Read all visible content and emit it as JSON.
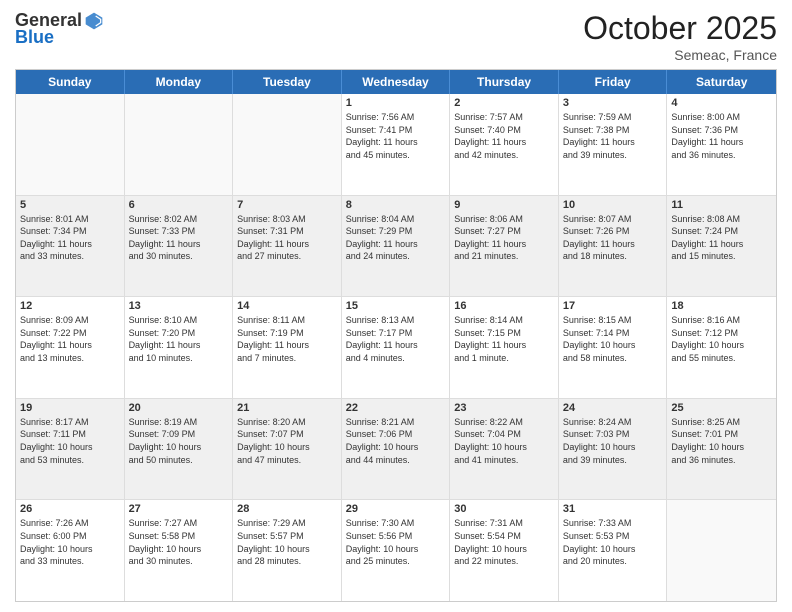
{
  "header": {
    "logo_line1": "General",
    "logo_line2": "Blue",
    "month": "October 2025",
    "location": "Semeac, France"
  },
  "days_of_week": [
    "Sunday",
    "Monday",
    "Tuesday",
    "Wednesday",
    "Thursday",
    "Friday",
    "Saturday"
  ],
  "weeks": [
    [
      {
        "day": "",
        "info": "",
        "empty": true
      },
      {
        "day": "",
        "info": "",
        "empty": true
      },
      {
        "day": "",
        "info": "",
        "empty": true
      },
      {
        "day": "1",
        "info": "Sunrise: 7:56 AM\nSunset: 7:41 PM\nDaylight: 11 hours\nand 45 minutes."
      },
      {
        "day": "2",
        "info": "Sunrise: 7:57 AM\nSunset: 7:40 PM\nDaylight: 11 hours\nand 42 minutes."
      },
      {
        "day": "3",
        "info": "Sunrise: 7:59 AM\nSunset: 7:38 PM\nDaylight: 11 hours\nand 39 minutes."
      },
      {
        "day": "4",
        "info": "Sunrise: 8:00 AM\nSunset: 7:36 PM\nDaylight: 11 hours\nand 36 minutes."
      }
    ],
    [
      {
        "day": "5",
        "info": "Sunrise: 8:01 AM\nSunset: 7:34 PM\nDaylight: 11 hours\nand 33 minutes."
      },
      {
        "day": "6",
        "info": "Sunrise: 8:02 AM\nSunset: 7:33 PM\nDaylight: 11 hours\nand 30 minutes."
      },
      {
        "day": "7",
        "info": "Sunrise: 8:03 AM\nSunset: 7:31 PM\nDaylight: 11 hours\nand 27 minutes."
      },
      {
        "day": "8",
        "info": "Sunrise: 8:04 AM\nSunset: 7:29 PM\nDaylight: 11 hours\nand 24 minutes."
      },
      {
        "day": "9",
        "info": "Sunrise: 8:06 AM\nSunset: 7:27 PM\nDaylight: 11 hours\nand 21 minutes."
      },
      {
        "day": "10",
        "info": "Sunrise: 8:07 AM\nSunset: 7:26 PM\nDaylight: 11 hours\nand 18 minutes."
      },
      {
        "day": "11",
        "info": "Sunrise: 8:08 AM\nSunset: 7:24 PM\nDaylight: 11 hours\nand 15 minutes."
      }
    ],
    [
      {
        "day": "12",
        "info": "Sunrise: 8:09 AM\nSunset: 7:22 PM\nDaylight: 11 hours\nand 13 minutes."
      },
      {
        "day": "13",
        "info": "Sunrise: 8:10 AM\nSunset: 7:20 PM\nDaylight: 11 hours\nand 10 minutes."
      },
      {
        "day": "14",
        "info": "Sunrise: 8:11 AM\nSunset: 7:19 PM\nDaylight: 11 hours\nand 7 minutes."
      },
      {
        "day": "15",
        "info": "Sunrise: 8:13 AM\nSunset: 7:17 PM\nDaylight: 11 hours\nand 4 minutes."
      },
      {
        "day": "16",
        "info": "Sunrise: 8:14 AM\nSunset: 7:15 PM\nDaylight: 11 hours\nand 1 minute."
      },
      {
        "day": "17",
        "info": "Sunrise: 8:15 AM\nSunset: 7:14 PM\nDaylight: 10 hours\nand 58 minutes."
      },
      {
        "day": "18",
        "info": "Sunrise: 8:16 AM\nSunset: 7:12 PM\nDaylight: 10 hours\nand 55 minutes."
      }
    ],
    [
      {
        "day": "19",
        "info": "Sunrise: 8:17 AM\nSunset: 7:11 PM\nDaylight: 10 hours\nand 53 minutes."
      },
      {
        "day": "20",
        "info": "Sunrise: 8:19 AM\nSunset: 7:09 PM\nDaylight: 10 hours\nand 50 minutes."
      },
      {
        "day": "21",
        "info": "Sunrise: 8:20 AM\nSunset: 7:07 PM\nDaylight: 10 hours\nand 47 minutes."
      },
      {
        "day": "22",
        "info": "Sunrise: 8:21 AM\nSunset: 7:06 PM\nDaylight: 10 hours\nand 44 minutes."
      },
      {
        "day": "23",
        "info": "Sunrise: 8:22 AM\nSunset: 7:04 PM\nDaylight: 10 hours\nand 41 minutes."
      },
      {
        "day": "24",
        "info": "Sunrise: 8:24 AM\nSunset: 7:03 PM\nDaylight: 10 hours\nand 39 minutes."
      },
      {
        "day": "25",
        "info": "Sunrise: 8:25 AM\nSunset: 7:01 PM\nDaylight: 10 hours\nand 36 minutes."
      }
    ],
    [
      {
        "day": "26",
        "info": "Sunrise: 7:26 AM\nSunset: 6:00 PM\nDaylight: 10 hours\nand 33 minutes."
      },
      {
        "day": "27",
        "info": "Sunrise: 7:27 AM\nSunset: 5:58 PM\nDaylight: 10 hours\nand 30 minutes."
      },
      {
        "day": "28",
        "info": "Sunrise: 7:29 AM\nSunset: 5:57 PM\nDaylight: 10 hours\nand 28 minutes."
      },
      {
        "day": "29",
        "info": "Sunrise: 7:30 AM\nSunset: 5:56 PM\nDaylight: 10 hours\nand 25 minutes."
      },
      {
        "day": "30",
        "info": "Sunrise: 7:31 AM\nSunset: 5:54 PM\nDaylight: 10 hours\nand 22 minutes."
      },
      {
        "day": "31",
        "info": "Sunrise: 7:33 AM\nSunset: 5:53 PM\nDaylight: 10 hours\nand 20 minutes."
      },
      {
        "day": "",
        "info": "",
        "empty": true
      }
    ]
  ]
}
